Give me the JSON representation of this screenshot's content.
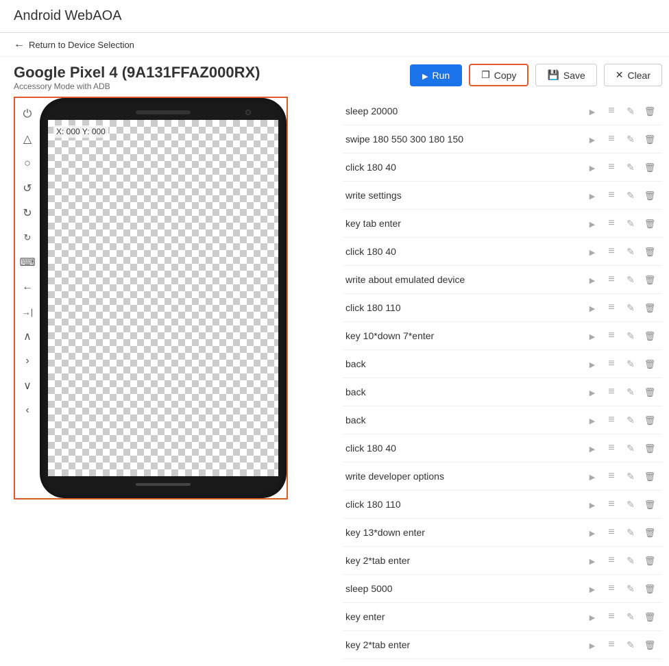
{
  "app": {
    "title": "Android WebAOA"
  },
  "nav": {
    "back_label": "Return to Device Selection"
  },
  "device": {
    "name": "Google Pixel 4 (9A131FFAZ000RX)",
    "mode": "Accessory Mode with ADB",
    "coords": "X: 000 Y: 000"
  },
  "toolbar": {
    "run_label": "Run",
    "copy_label": "Copy",
    "save_label": "Save",
    "clear_label": "Clear"
  },
  "commands": [
    {
      "id": 1,
      "text": "sleep 20000"
    },
    {
      "id": 2,
      "text": "swipe 180 550 300 180 150"
    },
    {
      "id": 3,
      "text": "click 180 40"
    },
    {
      "id": 4,
      "text": "write settings"
    },
    {
      "id": 5,
      "text": "key tab enter"
    },
    {
      "id": 6,
      "text": "click 180 40"
    },
    {
      "id": 7,
      "text": "write about emulated device"
    },
    {
      "id": 8,
      "text": "click 180 110"
    },
    {
      "id": 9,
      "text": "key 10*down 7*enter"
    },
    {
      "id": 10,
      "text": "back"
    },
    {
      "id": 11,
      "text": "back"
    },
    {
      "id": 12,
      "text": "back"
    },
    {
      "id": 13,
      "text": "click 180 40"
    },
    {
      "id": 14,
      "text": "write developer options"
    },
    {
      "id": 15,
      "text": "click 180 110"
    },
    {
      "id": 16,
      "text": "key 13*down enter"
    },
    {
      "id": 17,
      "text": "key 2*tab enter"
    },
    {
      "id": 18,
      "text": "sleep 5000"
    },
    {
      "id": 19,
      "text": "key enter"
    },
    {
      "id": 20,
      "text": "key 2*tab enter"
    }
  ],
  "side_controls": [
    {
      "name": "power",
      "symbol": "⏻"
    },
    {
      "name": "home",
      "symbol": "△"
    },
    {
      "name": "circle",
      "symbol": "○"
    },
    {
      "name": "rotate-ccw",
      "symbol": "↺"
    },
    {
      "name": "rotate-cw",
      "symbol": "↻"
    },
    {
      "name": "rotate-step",
      "symbol": "↻"
    },
    {
      "name": "keyboard",
      "symbol": "⌨"
    },
    {
      "name": "arrow-left",
      "symbol": "←"
    },
    {
      "name": "arrow-right",
      "symbol": "→|"
    },
    {
      "name": "chevron-up",
      "symbol": "∧"
    },
    {
      "name": "chevron-right",
      "symbol": "›"
    },
    {
      "name": "chevron-down",
      "symbol": "∨"
    },
    {
      "name": "chevron-left-small",
      "symbol": "‹"
    }
  ]
}
